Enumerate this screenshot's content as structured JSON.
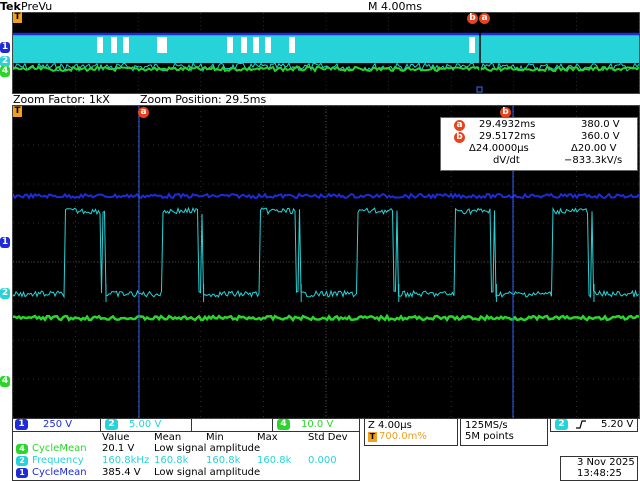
{
  "header": {
    "brand": "Tek",
    "mode": "PreVu",
    "timebase": "M 4.00ms",
    "trigger_marker": "T"
  },
  "overview_cursors": {
    "a": "a",
    "b": "b"
  },
  "channel_markers": {
    "ch1": "1",
    "ch2": "2",
    "ch4": "4"
  },
  "zoom": {
    "factor": "Zoom Factor: 1kX",
    "position": "Zoom Position: 29.5ms"
  },
  "cursor_readout": {
    "a_label": "a",
    "b_label": "b",
    "a_time": "29.4932ms",
    "a_value": "380.0 V",
    "b_time": "29.5172ms",
    "b_value": "360.0 V",
    "delta_time": "Δ24.0000µs",
    "delta_value": "Δ20.00 V",
    "slope_label": "dV/dt",
    "slope_value": "−833.3kV/s"
  },
  "scales": {
    "ch1": {
      "num": "1",
      "value": "250 V"
    },
    "ch2": {
      "num": "2",
      "value": "5.00 V"
    },
    "ch4": {
      "num": "4",
      "value": "10.0 V"
    }
  },
  "horizontal": {
    "zoom_scale": "Z 4.00µs",
    "trigger_pos": "700.0m%"
  },
  "acquisition": {
    "rate": "125MS/s",
    "record": "5M points"
  },
  "trigger": {
    "source": "2",
    "slope_icon": "rising-edge",
    "level": "5.20 V"
  },
  "measurements": {
    "headers": [
      "Value",
      "Mean",
      "Min",
      "Max",
      "Std Dev"
    ],
    "rows": [
      {
        "ch": "4",
        "name": "CycleMean",
        "value": "20.1 V",
        "mean": "Low signal amplitude",
        "min": "",
        "max": "",
        "std": "",
        "color": "#2bd62b"
      },
      {
        "ch": "2",
        "name": "Frequency",
        "value": "160.8kHz",
        "mean": "160.8k",
        "min": "160.8k",
        "max": "160.8k",
        "std": "0.000",
        "color": "#25d3d8"
      },
      {
        "ch": "1",
        "name": "CycleMean",
        "value": "385.4 V",
        "mean": "Low signal amplitude",
        "min": "",
        "max": "",
        "std": "",
        "color": "#1f2bd6"
      }
    ]
  },
  "datetime": {
    "date": "3 Nov 2025",
    "time": "13:48:25"
  },
  "colors": {
    "ch1": "#1f2bd6",
    "ch2": "#25d3d8",
    "ch4": "#2bd62b",
    "cursor": "#e8431d",
    "trigger": "#f0a020"
  }
}
